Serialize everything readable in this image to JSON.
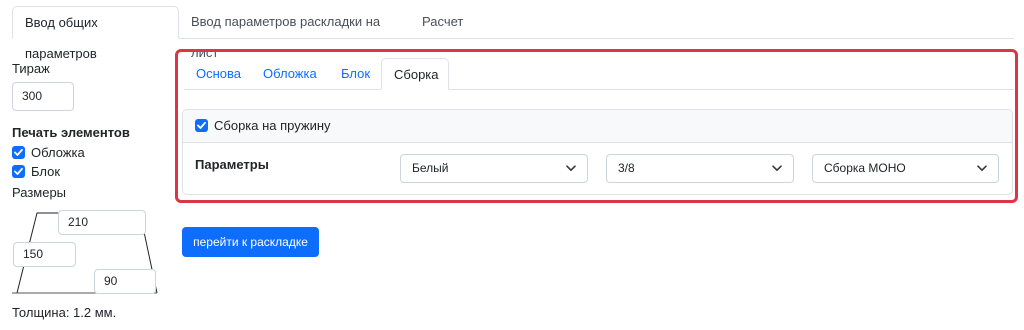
{
  "top_tabs": [
    {
      "label": "Ввод общих параметров"
    },
    {
      "label": "Ввод параметров раскладки на лист"
    },
    {
      "label": "Расчет"
    }
  ],
  "left": {
    "tirazh_label": "Тираж",
    "tirazh_value": "300",
    "print_elements_label": "Печать элементов",
    "elements": [
      {
        "label": "Обложка",
        "checked": true
      },
      {
        "label": "Блок",
        "checked": true
      }
    ],
    "sizes_label": "Размеры",
    "sizes": {
      "top": "210",
      "left": "150",
      "bottom": "90"
    },
    "thickness_text": "Толщина: 1.2 мм."
  },
  "inner_tabs": [
    {
      "label": "Основа"
    },
    {
      "label": "Обложка"
    },
    {
      "label": "Блок"
    },
    {
      "label": "Сборка"
    }
  ],
  "assembly": {
    "spring_label": "Сборка на пружину",
    "spring_checked": true,
    "params_label": "Параметры",
    "selects": [
      {
        "value": "Белый"
      },
      {
        "value": "3/8"
      },
      {
        "value": "Сборка МОНО"
      }
    ]
  },
  "action_button": "перейти к раскладке",
  "colors": {
    "accent": "#0d6efd",
    "highlight_frame": "#dc3545"
  }
}
